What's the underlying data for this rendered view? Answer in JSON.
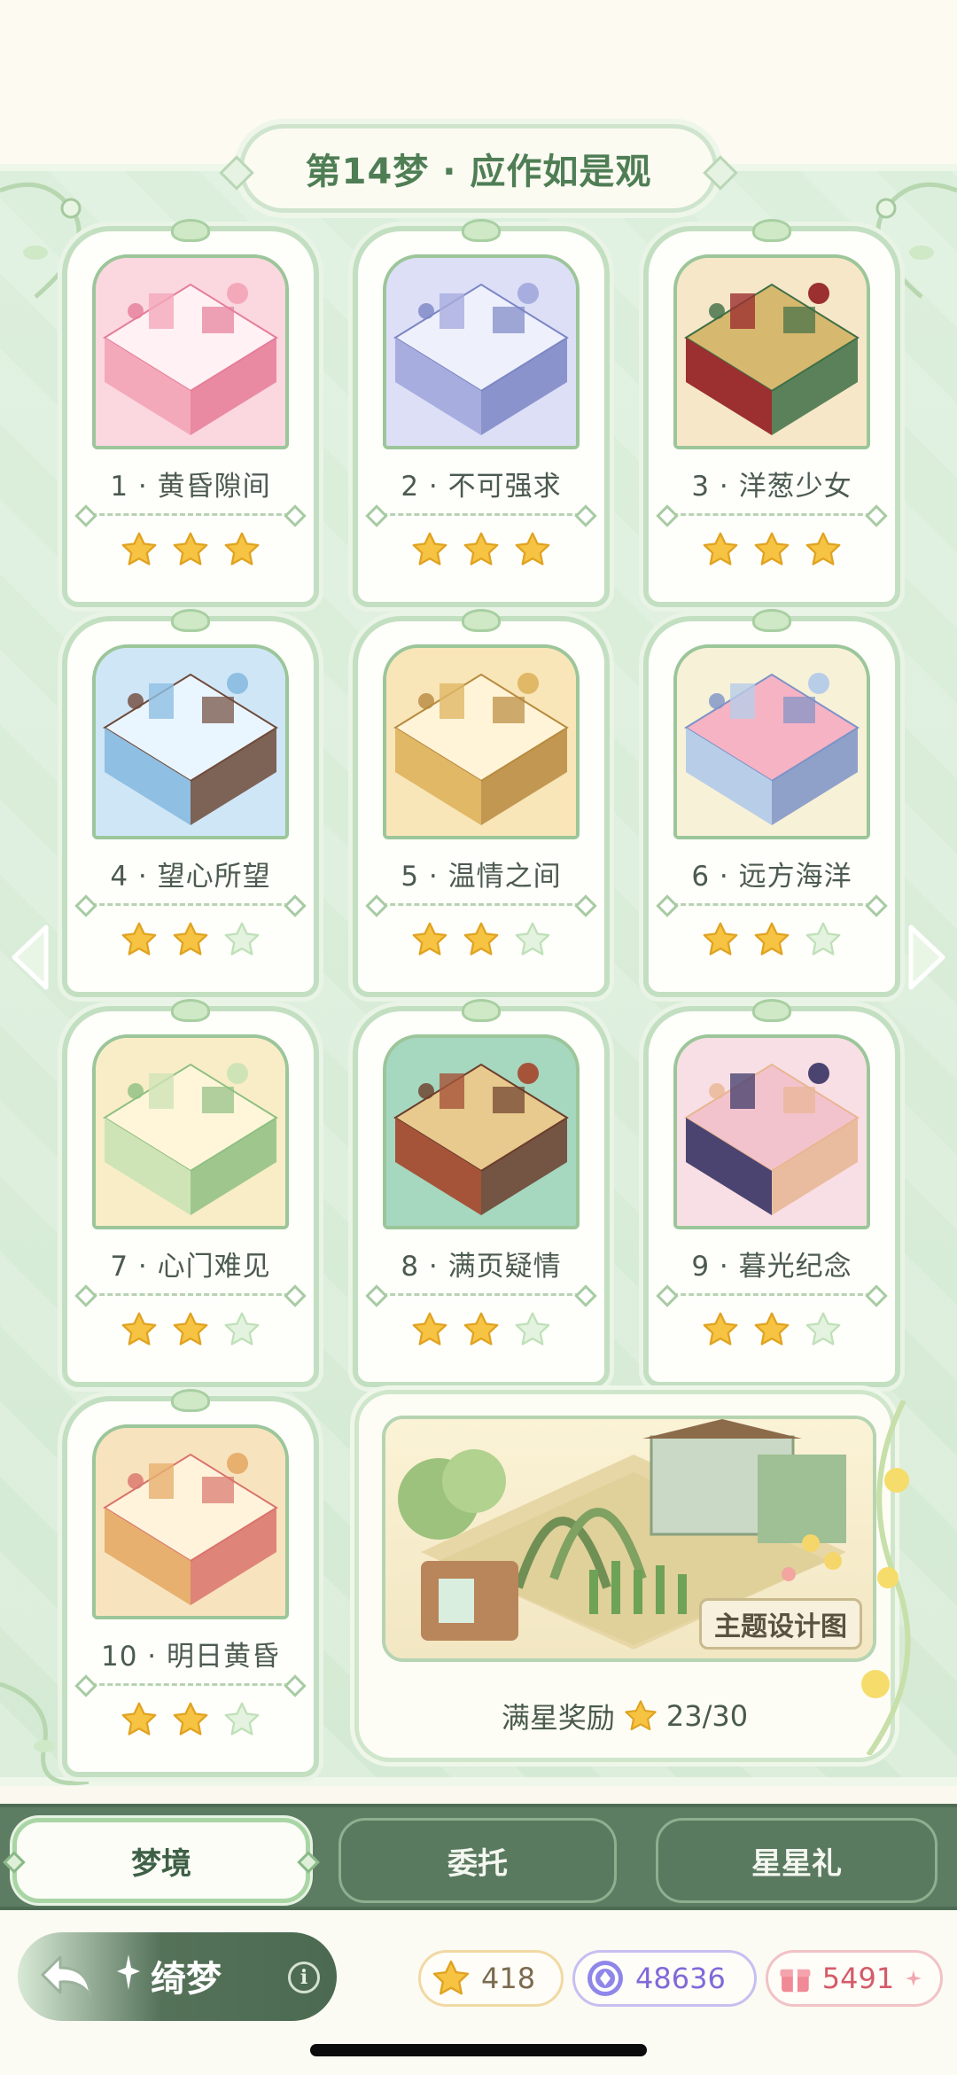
{
  "header": {
    "title": "第14梦 · 应作如是观"
  },
  "levels": [
    {
      "label": "1 · 黄昏隙间",
      "stars": 3,
      "theme": "pink"
    },
    {
      "label": "2 · 不可强求",
      "stars": 3,
      "theme": "lavender"
    },
    {
      "label": "3 · 洋葱少女",
      "stars": 3,
      "theme": "red-green"
    },
    {
      "label": "4 · 望心所望",
      "stars": 2,
      "theme": "blue"
    },
    {
      "label": "5 · 温情之间",
      "stars": 2,
      "theme": "gold"
    },
    {
      "label": "6 · 远方海洋",
      "stars": 2,
      "theme": "sea"
    },
    {
      "label": "7 · 心门难见",
      "stars": 2,
      "theme": "green"
    },
    {
      "label": "8 · 满页疑情",
      "stars": 2,
      "theme": "brown"
    },
    {
      "label": "9 · 暮光纪念",
      "stars": 2,
      "theme": "rose"
    },
    {
      "label": "10 · 明日黄昏",
      "stars": 2,
      "theme": "peach"
    }
  ],
  "feature": {
    "tag": "主题设计图",
    "reward_label": "满星奖励",
    "reward_progress": "23/30"
  },
  "tabs": [
    {
      "label": "梦境",
      "active": true
    },
    {
      "label": "委托",
      "active": false
    },
    {
      "label": "星星礼",
      "active": false
    }
  ],
  "footer": {
    "mode": "绮梦",
    "info": "i",
    "currencies": [
      {
        "icon": "star-icon",
        "value": "418"
      },
      {
        "icon": "gem-icon",
        "value": "48636"
      },
      {
        "icon": "gift-icon",
        "value": "5491"
      }
    ]
  },
  "colors": {
    "star_filled": "#f6c343",
    "star_empty": "#e4f3df",
    "accent_green": "#5d7d63"
  }
}
